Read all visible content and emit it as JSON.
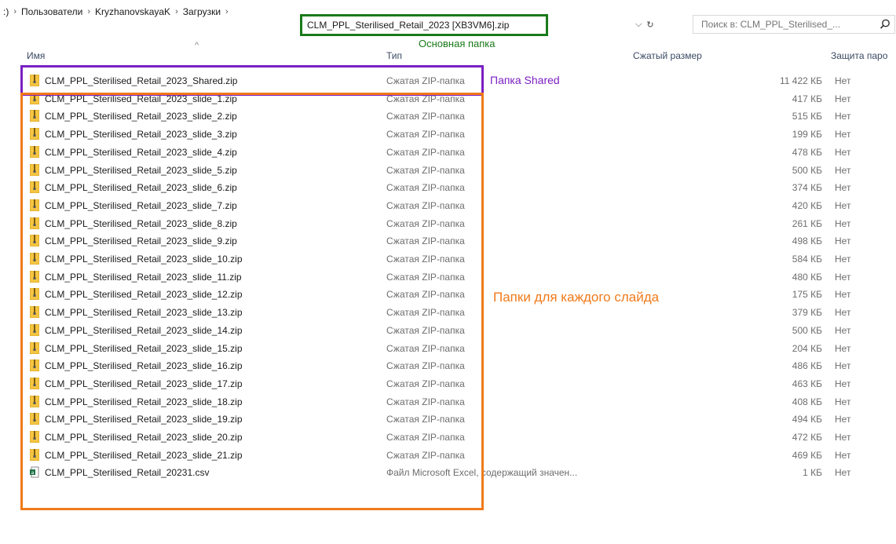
{
  "address": {
    "crumbs": [
      ":)",
      "Пользователи",
      "KryzhanovskayaK",
      "Загрузки"
    ],
    "current": "CLM_PPL_Sterilised_Retail_2023 [XB3VM6].zip",
    "search_placeholder": "Поиск в: CLM_PPL_Sterilised_..."
  },
  "annotations": {
    "main_folder": "Основная папка",
    "shared_folder": "Папка Shared",
    "slide_folders": "Папки для каждого слайда"
  },
  "columns": {
    "name": "Имя",
    "type": "Тип",
    "compressed_size": "Сжатый размер",
    "protection": "Защита паро"
  },
  "colors": {
    "main_box": "#1a7a1a",
    "shared_box": "#7b1fc2",
    "slides_box": "#f07a1a"
  },
  "files": [
    {
      "name": "CLM_PPL_Sterilised_Retail_2023_Shared.zip",
      "type": "Сжатая ZIP-папка",
      "size": "11 422 КБ",
      "prot": "Нет",
      "icon": "zip-folder-icon"
    },
    {
      "name": "CLM_PPL_Sterilised_Retail_2023_slide_1.zip",
      "type": "Сжатая ZIP-папка",
      "size": "417 КБ",
      "prot": "Нет",
      "icon": "zip-folder-icon"
    },
    {
      "name": "CLM_PPL_Sterilised_Retail_2023_slide_2.zip",
      "type": "Сжатая ZIP-папка",
      "size": "515 КБ",
      "prot": "Нет",
      "icon": "zip-folder-icon"
    },
    {
      "name": "CLM_PPL_Sterilised_Retail_2023_slide_3.zip",
      "type": "Сжатая ZIP-папка",
      "size": "199 КБ",
      "prot": "Нет",
      "icon": "zip-folder-icon"
    },
    {
      "name": "CLM_PPL_Sterilised_Retail_2023_slide_4.zip",
      "type": "Сжатая ZIP-папка",
      "size": "478 КБ",
      "prot": "Нет",
      "icon": "zip-folder-icon"
    },
    {
      "name": "CLM_PPL_Sterilised_Retail_2023_slide_5.zip",
      "type": "Сжатая ZIP-папка",
      "size": "500 КБ",
      "prot": "Нет",
      "icon": "zip-folder-icon"
    },
    {
      "name": "CLM_PPL_Sterilised_Retail_2023_slide_6.zip",
      "type": "Сжатая ZIP-папка",
      "size": "374 КБ",
      "prot": "Нет",
      "icon": "zip-folder-icon"
    },
    {
      "name": "CLM_PPL_Sterilised_Retail_2023_slide_7.zip",
      "type": "Сжатая ZIP-папка",
      "size": "420 КБ",
      "prot": "Нет",
      "icon": "zip-folder-icon"
    },
    {
      "name": "CLM_PPL_Sterilised_Retail_2023_slide_8.zip",
      "type": "Сжатая ZIP-папка",
      "size": "261 КБ",
      "prot": "Нет",
      "icon": "zip-folder-icon"
    },
    {
      "name": "CLM_PPL_Sterilised_Retail_2023_slide_9.zip",
      "type": "Сжатая ZIP-папка",
      "size": "498 КБ",
      "prot": "Нет",
      "icon": "zip-folder-icon"
    },
    {
      "name": "CLM_PPL_Sterilised_Retail_2023_slide_10.zip",
      "type": "Сжатая ZIP-папка",
      "size": "584 КБ",
      "prot": "Нет",
      "icon": "zip-folder-icon"
    },
    {
      "name": "CLM_PPL_Sterilised_Retail_2023_slide_11.zip",
      "type": "Сжатая ZIP-папка",
      "size": "480 КБ",
      "prot": "Нет",
      "icon": "zip-folder-icon"
    },
    {
      "name": "CLM_PPL_Sterilised_Retail_2023_slide_12.zip",
      "type": "Сжатая ZIP-папка",
      "size": "175 КБ",
      "prot": "Нет",
      "icon": "zip-folder-icon"
    },
    {
      "name": "CLM_PPL_Sterilised_Retail_2023_slide_13.zip",
      "type": "Сжатая ZIP-папка",
      "size": "379 КБ",
      "prot": "Нет",
      "icon": "zip-folder-icon"
    },
    {
      "name": "CLM_PPL_Sterilised_Retail_2023_slide_14.zip",
      "type": "Сжатая ZIP-папка",
      "size": "500 КБ",
      "prot": "Нет",
      "icon": "zip-folder-icon"
    },
    {
      "name": "CLM_PPL_Sterilised_Retail_2023_slide_15.zip",
      "type": "Сжатая ZIP-папка",
      "size": "204 КБ",
      "prot": "Нет",
      "icon": "zip-folder-icon"
    },
    {
      "name": "CLM_PPL_Sterilised_Retail_2023_slide_16.zip",
      "type": "Сжатая ZIP-папка",
      "size": "486 КБ",
      "prot": "Нет",
      "icon": "zip-folder-icon"
    },
    {
      "name": "CLM_PPL_Sterilised_Retail_2023_slide_17.zip",
      "type": "Сжатая ZIP-папка",
      "size": "463 КБ",
      "prot": "Нет",
      "icon": "zip-folder-icon"
    },
    {
      "name": "CLM_PPL_Sterilised_Retail_2023_slide_18.zip",
      "type": "Сжатая ZIP-папка",
      "size": "408 КБ",
      "prot": "Нет",
      "icon": "zip-folder-icon"
    },
    {
      "name": "CLM_PPL_Sterilised_Retail_2023_slide_19.zip",
      "type": "Сжатая ZIP-папка",
      "size": "494 КБ",
      "prot": "Нет",
      "icon": "zip-folder-icon"
    },
    {
      "name": "CLM_PPL_Sterilised_Retail_2023_slide_20.zip",
      "type": "Сжатая ZIP-папка",
      "size": "472 КБ",
      "prot": "Нет",
      "icon": "zip-folder-icon"
    },
    {
      "name": "CLM_PPL_Sterilised_Retail_2023_slide_21.zip",
      "type": "Сжатая ZIP-папка",
      "size": "469 КБ",
      "prot": "Нет",
      "icon": "zip-folder-icon"
    },
    {
      "name": "CLM_PPL_Sterilised_Retail_20231.csv",
      "type": "Файл Microsoft Excel, содержащий значен...",
      "size": "1 КБ",
      "prot": "Нет",
      "icon": "excel-csv-icon"
    }
  ]
}
